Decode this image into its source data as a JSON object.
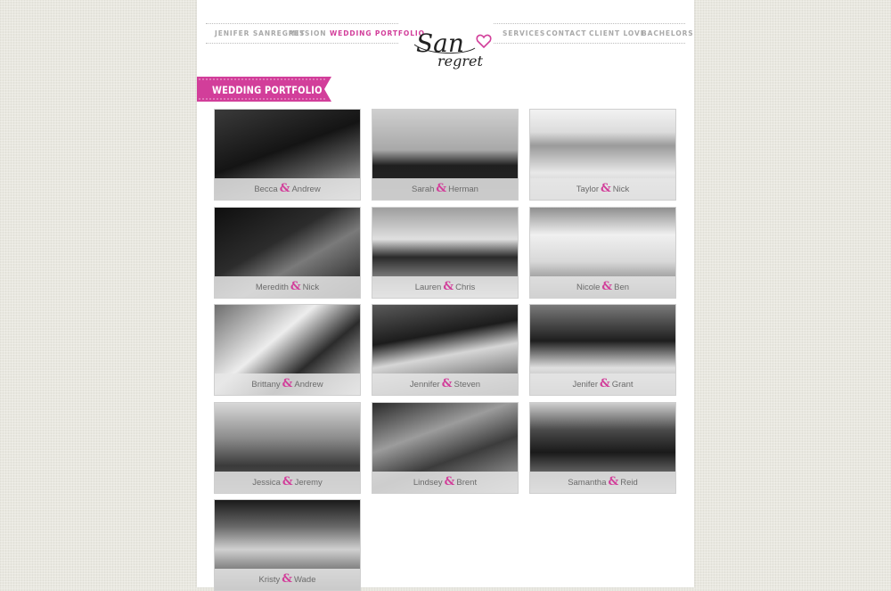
{
  "nav": {
    "left": [
      "JENIFER SANREGRET",
      "MISSION",
      "WEDDING PORTFOLIO"
    ],
    "right": [
      "SERVICES",
      "CONTACT",
      "CLIENT LOVE",
      "BACHELORS"
    ],
    "active": "WEDDING PORTFOLIO"
  },
  "logo": {
    "line1": "San",
    "line2": "regret",
    "icon": "heart-icon"
  },
  "section_title": "WEDDING PORTFOLIO",
  "accent_color": "#d23e9a",
  "amp": "&",
  "couples": [
    {
      "a": "Becca",
      "b": "Andrew"
    },
    {
      "a": "Sarah",
      "b": "Herman"
    },
    {
      "a": "Taylor",
      "b": "Nick"
    },
    {
      "a": "Meredith",
      "b": "Nick"
    },
    {
      "a": "Lauren",
      "b": "Chris"
    },
    {
      "a": "Nicole",
      "b": "Ben"
    },
    {
      "a": "Brittany",
      "b": "Andrew"
    },
    {
      "a": "Jennifer",
      "b": "Steven"
    },
    {
      "a": "Jenifer",
      "b": "Grant"
    },
    {
      "a": "Jessica",
      "b": "Jeremy"
    },
    {
      "a": "Lindsey",
      "b": "Brent"
    },
    {
      "a": "Samantha",
      "b": "Reid"
    },
    {
      "a": "Kristy",
      "b": "Wade"
    }
  ]
}
